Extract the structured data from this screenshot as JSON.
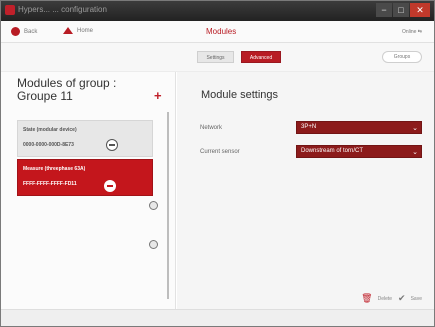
{
  "window": {
    "title": "Hypers... ... configuration",
    "controls": {
      "minimize": "−",
      "maximize": "□",
      "close": "✕"
    }
  },
  "nav": {
    "back_label": "Back",
    "home_label": "Home",
    "page_title": "Modules",
    "right_label": "Online ⇆"
  },
  "tabs": [
    {
      "label": "Settings"
    },
    {
      "label": "Advanced"
    }
  ],
  "groups_button": "Groups",
  "group": {
    "title": "Modules of group :",
    "name": "Groupe  11",
    "add_icon": "plus-icon"
  },
  "devices": [
    {
      "name": "State (modular device)",
      "id": "0000-0000-000D-8E73",
      "selected": false
    },
    {
      "name": "Measure (threephase 63A)",
      "id": "FFFF-FFFF-FFFF-FD11",
      "selected": true
    }
  ],
  "settings": {
    "title": "Module settings",
    "network_label": "Network",
    "network_value": "3P+N",
    "sensor_label": "Current sensor",
    "sensor_value": "Downstream of torn/CT"
  },
  "footer": {
    "delete_label": "Delete",
    "save_label": "Save"
  },
  "colors": {
    "accent": "#b81c24",
    "select_bg": "#8c1b1b",
    "selected_device": "#c4161c"
  }
}
